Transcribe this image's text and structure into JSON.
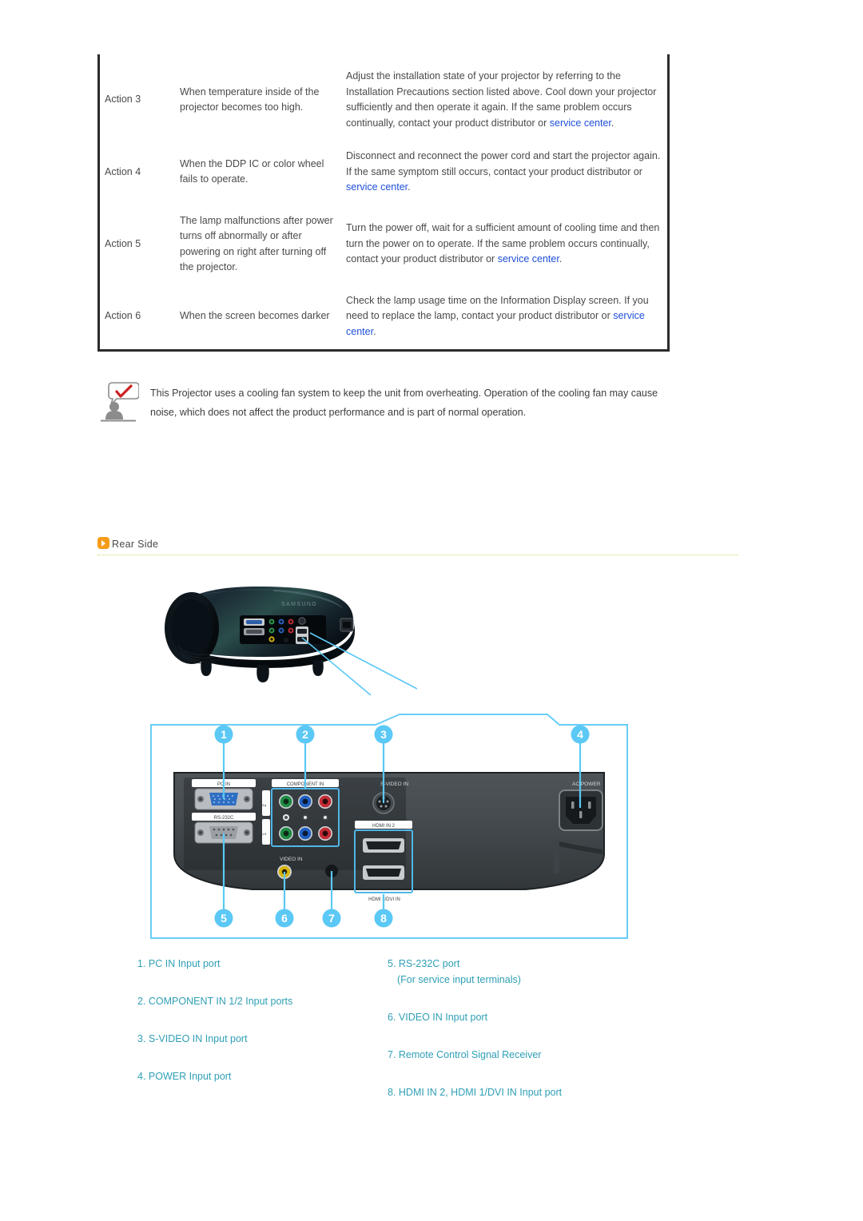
{
  "troubleshoot_table": {
    "rows": [
      {
        "action": "Action 3",
        "symptom": "When temperature inside of the projector becomes too high.",
        "remedy_before": "Adjust the installation state of your projector by referring to the Installation Precautions section listed above. Cool down your projector sufficiently and then operate it again. If the same problem occurs continually, contact your product distributor or ",
        "remedy_link": "service center",
        "remedy_after": "."
      },
      {
        "action": "Action 4",
        "symptom": "When the DDP IC or color wheel fails to operate.",
        "remedy_before": "Disconnect and reconnect the power cord and start the projector again. If the same symptom still occurs, contact your product distributor or ",
        "remedy_link": "service center",
        "remedy_after": "."
      },
      {
        "action": "Action 5",
        "symptom": "The lamp malfunctions after power turns off abnormally or after powering on right after turning off the projector.",
        "remedy_before": "Turn the power off, wait for a sufficient amount of cooling time and then turn the power on to operate. If the same problem occurs continually, contact your product distributor or ",
        "remedy_link": "service center",
        "remedy_after": "."
      },
      {
        "action": "Action 6",
        "symptom": "When the screen becomes darker",
        "remedy_before": "Check the lamp usage time on the Information Display screen. If you need to replace the lamp, contact your product distributor or ",
        "remedy_link": "service center",
        "remedy_after": "."
      }
    ]
  },
  "note": {
    "icon": "person-speech-bubble-check-icon",
    "text": "This Projector uses a cooling fan system to keep the unit from overheating. Operation of the cooling fan may cause noise, which does not affect the product performance and is part of normal operation."
  },
  "section": {
    "bullet_icon": "chevron-right-icon",
    "title": "Rear Side"
  },
  "diagram": {
    "photo_alt": "projector-rear-photo",
    "callouts": [
      "1",
      "2",
      "3",
      "4",
      "5",
      "6",
      "7",
      "8"
    ],
    "port_labels": {
      "pc_in": "PC IN",
      "rs232c": "RS-232C",
      "component_in": "COMPONENT IN",
      "component_rows": [
        "2",
        "1"
      ],
      "svideo_in": "S-VIDEO IN",
      "hdmi_in_2": "HDMI IN 2",
      "hdmi_1_dvi_in": "HDMI 1/DVI IN",
      "video_in": "VIDEO IN",
      "power_in": "AC POWER"
    },
    "callout_color": "#5BC8F5"
  },
  "legend": {
    "left": [
      {
        "num": "1.",
        "label": "PC IN Input port",
        "sub": ""
      },
      {
        "num": "2.",
        "label": "COMPONENT IN 1/2 Input ports",
        "sub": ""
      },
      {
        "num": "3.",
        "label": "S-VIDEO IN Input port",
        "sub": ""
      },
      {
        "num": "4.",
        "label": "POWER Input port",
        "sub": ""
      }
    ],
    "right": [
      {
        "num": "5.",
        "label": "RS-232C port",
        "sub": "(For service input terminals)"
      },
      {
        "num": "6.",
        "label": "VIDEO IN Input port",
        "sub": ""
      },
      {
        "num": "7.",
        "label": "Remote Control Signal Receiver",
        "sub": ""
      },
      {
        "num": "8.",
        "label": "HDMI IN 2, HDMI 1/DVI IN Input port",
        "sub": ""
      }
    ]
  },
  "colors": {
    "link": "#1f4fd8",
    "legend_text": "#2f9fb5",
    "accent_orange": "#F79C19",
    "callout_blue": "#5BC8F5",
    "rule_green": "#c6d96a"
  }
}
